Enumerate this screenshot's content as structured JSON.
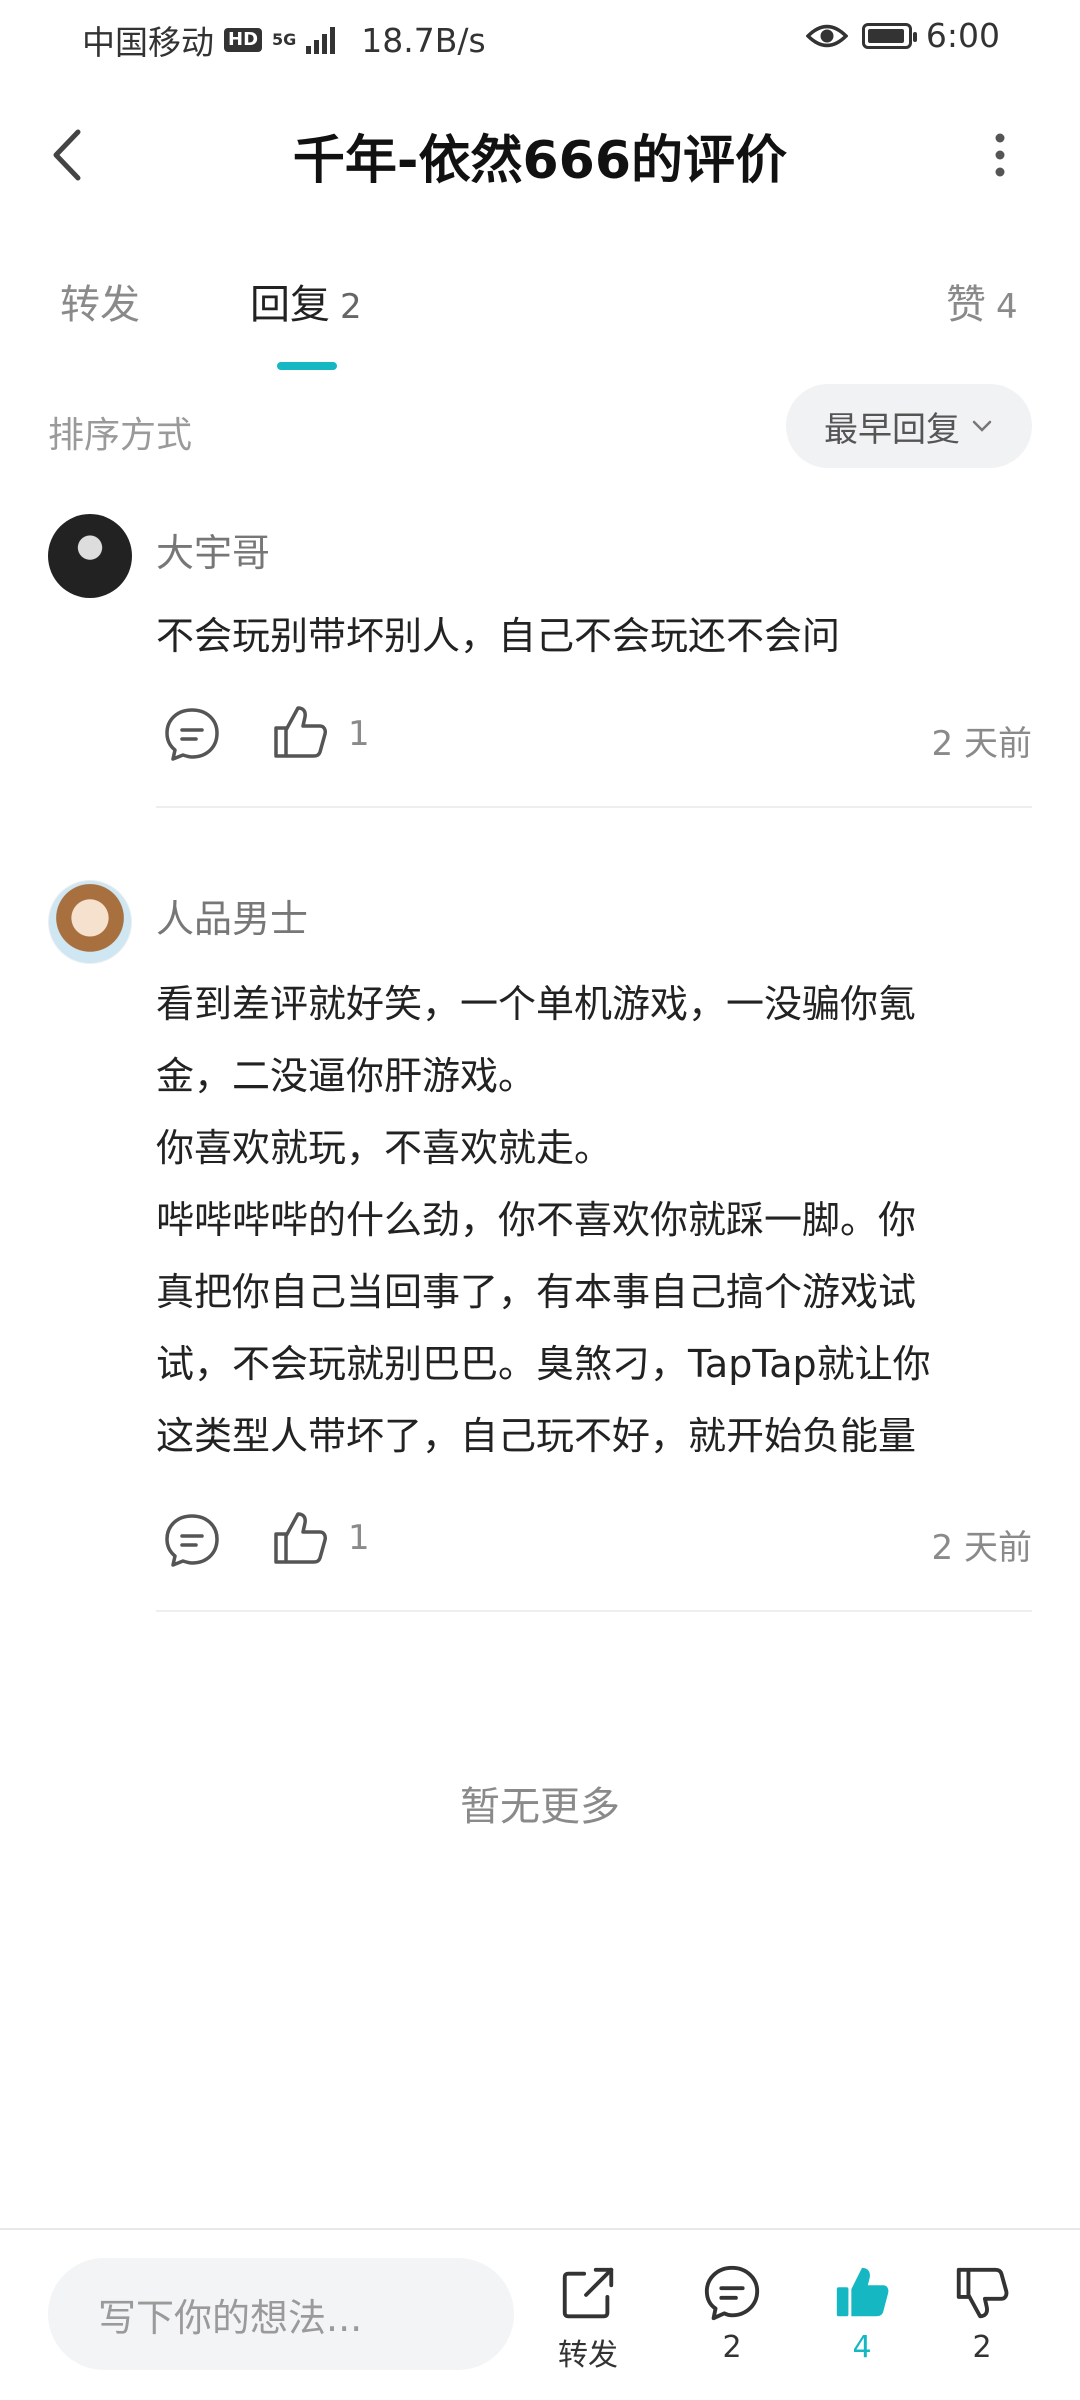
{
  "status_bar": {
    "carrier": "中国移动",
    "hd": "HD",
    "network": "5G",
    "speed": "18.7B/s",
    "time": "6:00"
  },
  "header": {
    "title": "千年-依然666的评价"
  },
  "tabs": [
    {
      "label": "转发",
      "count": ""
    },
    {
      "label": "回复",
      "count": "2"
    },
    {
      "label": "赞",
      "count": "4"
    }
  ],
  "sort": {
    "label": "排序方式",
    "value": "最早回复"
  },
  "comments": [
    {
      "username": "大宇哥",
      "text": "不会玩别带坏别人，自己不会玩还不会问",
      "likes": "1",
      "time": "2 天前"
    },
    {
      "username": "人品男士",
      "text": "看到差评就好笑，一个单机游戏，一没骗你氪\n金，二没逼你肝游戏。\n你喜欢就玩，不喜欢就走。\n哔哔哔哔的什么劲，你不喜欢你就踩一脚。你\n真把你自己当回事了，有本事自己搞个游戏试\n试，不会玩就别巴巴。臭煞刁，TapTap就让你\n这类型人带坏了，自己玩不好，就开始负能量",
      "likes": "1",
      "time": "2 天前"
    }
  ],
  "footer_note": "暂无更多",
  "bottom_bar": {
    "placeholder": "写下你的想法...",
    "share_label": "转发",
    "comment_count": "2",
    "like_count": "4",
    "dislike_count": "2"
  },
  "colors": {
    "accent": "#15b8c2"
  }
}
